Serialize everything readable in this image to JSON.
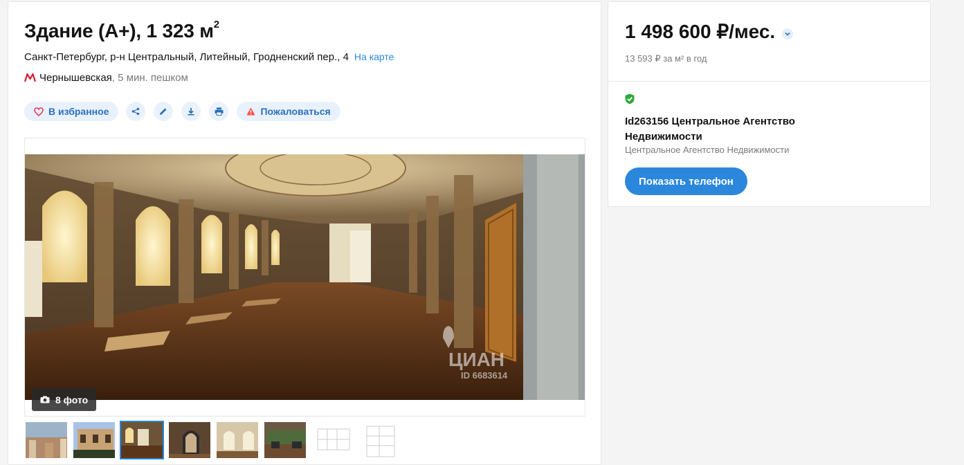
{
  "listing": {
    "title": "Здание (A+), 1 323 м",
    "title_sup": "2",
    "address": "Санкт-Петербург, р-н Центральный, Литейный, Гродненский пер., 4",
    "map_link": "На карте",
    "metro_station": "Чернышевская",
    "metro_time": ", 5 мин. пешком"
  },
  "actions": {
    "favorite_label": "В избранное",
    "share_icon": "share-icon",
    "edit_icon": "pencil-icon",
    "download_icon": "download-icon",
    "print_icon": "printer-icon",
    "complain_label": "Пожаловаться"
  },
  "gallery": {
    "photo_count_label": "8 фото",
    "watermark_brand": "ЦИАН",
    "watermark_id": "ID 6683614",
    "thumbnail_count": 8,
    "active_thumbnail": 3
  },
  "price": {
    "amount": "1 498 600 ₽/мес.",
    "per_m2": "13 593 ₽ за м² в год"
  },
  "agent": {
    "name": "Id263156 Центральное Агентство Недвижимости",
    "company": "Центральное Агентство Недвижимости",
    "phone_button": "Показать телефон"
  },
  "colors": {
    "accent": "#2b87db",
    "pill_bg": "#e9f2fc",
    "metro_red": "#d71c2b",
    "verified_green": "#2ea83a",
    "complain_red": "#ff4b3a"
  }
}
